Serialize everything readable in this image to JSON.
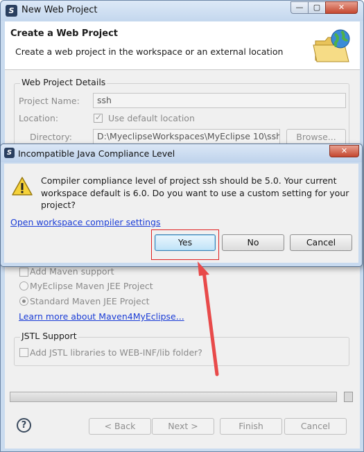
{
  "window": {
    "title": "New Web Project",
    "controls": {
      "minimize": "—",
      "maximize": "▢",
      "close": "✕"
    }
  },
  "banner": {
    "title": "Create a Web Project",
    "description": "Create a web project in the workspace or an external location"
  },
  "details": {
    "group_title": "Web Project Details",
    "project_name_label": "Project Name:",
    "project_name_value": "ssh",
    "location_label": "Location:",
    "use_default_location": "Use default location",
    "directory_label": "Directory:",
    "directory_value": "D:\\MyeclipseWorkspaces\\MyEclipse 10\\ssh",
    "browse_label": "Browse..."
  },
  "maven": {
    "add_maven_support": "Add Maven support",
    "radio_myeclipse_maven": "MyEclipse Maven JEE Project",
    "radio_standard_maven": "Standard Maven JEE Project",
    "learn_more_link": "Learn more about Maven4MyEclipse..."
  },
  "jstl": {
    "group_title": "JSTL Support",
    "add_jstl_label": "Add JSTL libraries to WEB-INF/lib folder?"
  },
  "footer": {
    "help": "?",
    "back": "< Back",
    "next": "Next >",
    "finish": "Finish",
    "cancel": "Cancel"
  },
  "dialog": {
    "title": "Incompatible Java Compliance Level",
    "close": "✕",
    "message": "Compiler compliance level of project ssh should be 5.0. Your current workspace default is 6.0. Do you want to use a custom setting for your project?",
    "link": "Open workspace compiler settings",
    "yes": "Yes",
    "no": "No",
    "cancel": "Cancel"
  },
  "colors": {
    "highlight_box": "#e02020",
    "arrow": "#e84a4a",
    "link": "#1a3cd6"
  }
}
